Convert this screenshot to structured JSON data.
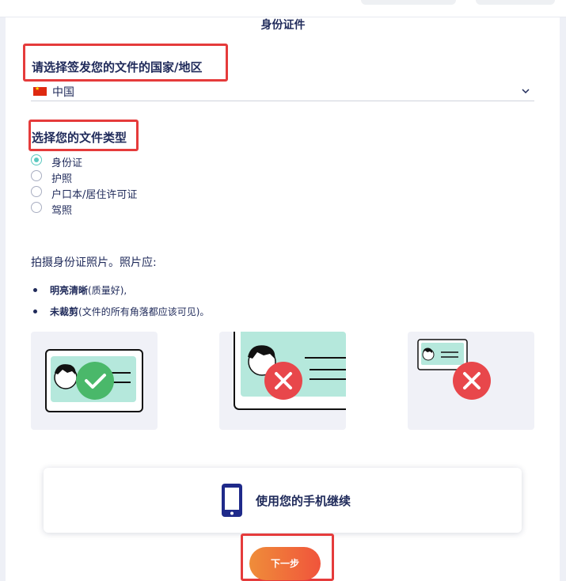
{
  "page": {
    "title": "身份证件"
  },
  "country": {
    "question": "请选择签发您的文件的国家/地区",
    "selected": "中国",
    "flag_icon": "china-flag-icon",
    "dropdown_icon": "chevron-down-icon"
  },
  "doc_type": {
    "question": "选择您的文件类型",
    "options": [
      {
        "label": "身份证",
        "checked": true
      },
      {
        "label": "护照",
        "checked": false
      },
      {
        "label": "户口本/居住许可证",
        "checked": false
      },
      {
        "label": "驾照",
        "checked": false
      }
    ]
  },
  "instructions": {
    "heading": "拍摄身份证照片。照片应:",
    "bullets": [
      {
        "strong": "明亮清晰",
        "rest": "(质量好),"
      },
      {
        "strong": "未裁剪",
        "rest": "(文件的所有角落都应该可见)。"
      }
    ]
  },
  "examples": [
    {
      "status": "correct",
      "icon": "check-icon"
    },
    {
      "status": "cropped",
      "icon": "cross-icon"
    },
    {
      "status": "too-small",
      "icon": "cross-icon"
    }
  ],
  "mobile": {
    "label": "使用您的手机继续",
    "icon": "smartphone-icon"
  },
  "next": {
    "label": "下一步"
  },
  "colors": {
    "text": "#1f2a5a",
    "accent_teal": "#5bc8bf",
    "error_red": "#e8474b",
    "success_green": "#4ab86a",
    "button_start": "#ef8d3a",
    "button_end": "#f0543b",
    "highlight_border": "#e53b3b"
  }
}
